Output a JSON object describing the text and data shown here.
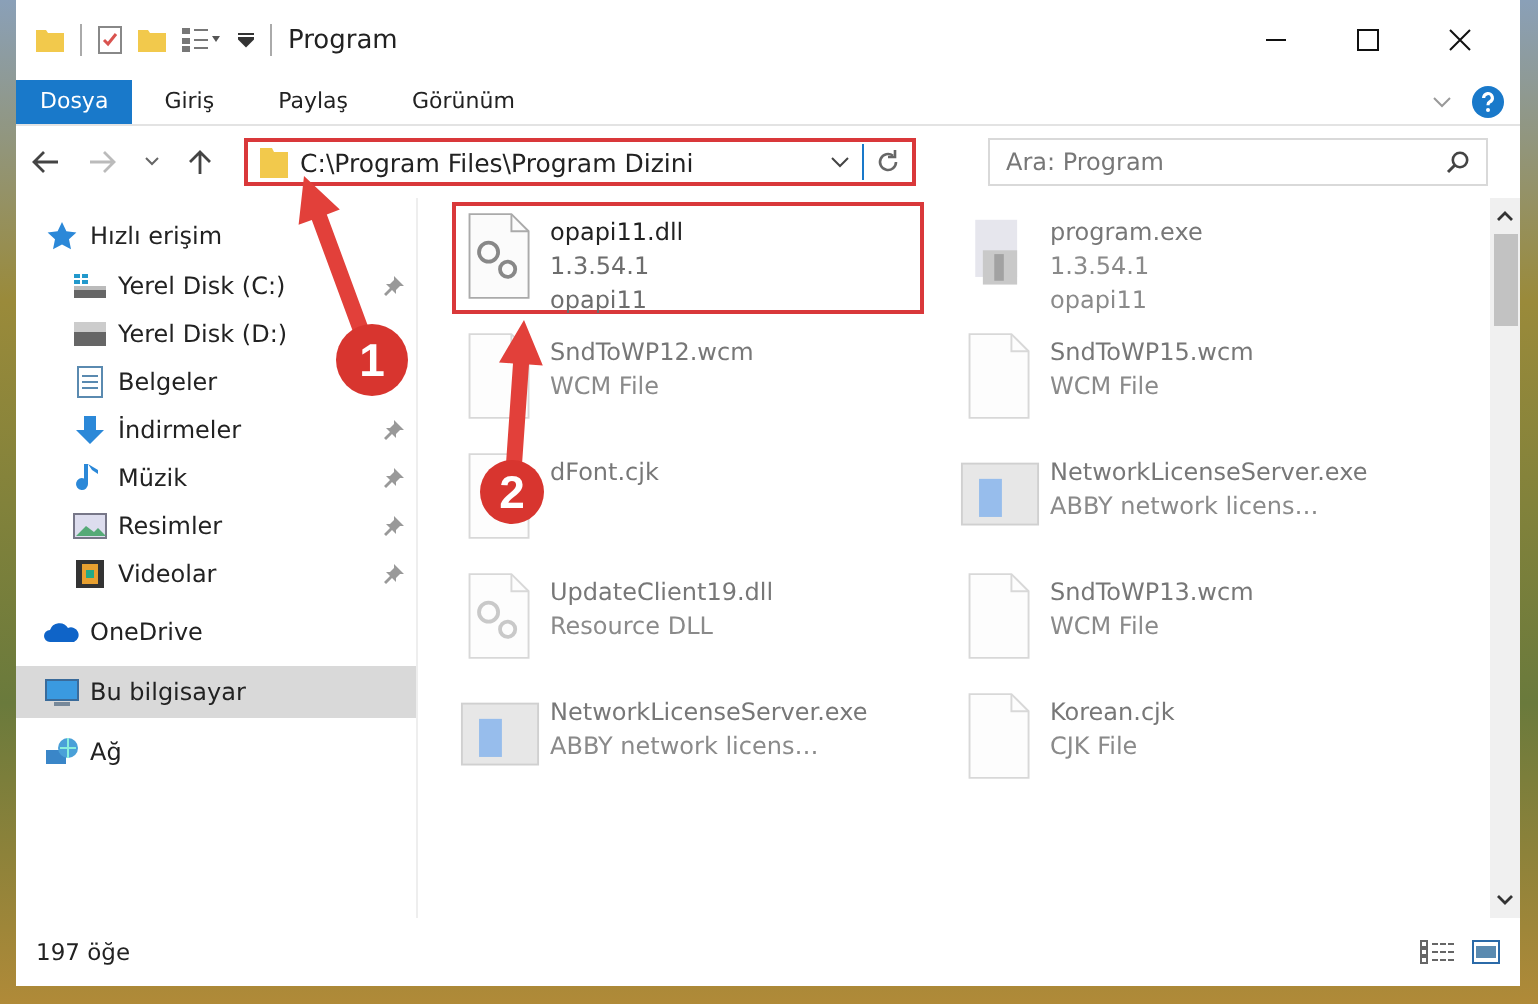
{
  "window": {
    "title": "Program"
  },
  "ribbon_tabs": [
    {
      "label": "Dosya",
      "kind": "file"
    },
    {
      "label": "Giriş",
      "kind": "tab"
    },
    {
      "label": "Paylaş",
      "kind": "tab"
    },
    {
      "label": "Görünüm",
      "kind": "tab"
    }
  ],
  "address_bar": {
    "path": "C:\\Program Files\\Program Dizini",
    "highlighted": true
  },
  "search": {
    "placeholder": "Ara: Program"
  },
  "sidebar": {
    "items": [
      {
        "label": "Hızlı erişim",
        "kind": "star",
        "selected": false,
        "children": [
          {
            "label": "Yerel Disk (C:)",
            "kind": "drive-win",
            "pinned": true
          },
          {
            "label": "Yerel Disk (D:)",
            "kind": "drive",
            "pinned": false
          },
          {
            "label": "Belgeler",
            "kind": "document",
            "pinned": false
          },
          {
            "label": "İndirmeler",
            "kind": "download",
            "pinned": true
          },
          {
            "label": "Müzik",
            "kind": "music",
            "pinned": true
          },
          {
            "label": "Resimler",
            "kind": "image",
            "pinned": true
          },
          {
            "label": "Videolar",
            "kind": "film",
            "pinned": true
          }
        ]
      },
      {
        "label": "OneDrive",
        "kind": "cloud",
        "selected": false
      },
      {
        "label": "Bu bilgisayar",
        "kind": "monitor",
        "selected": true
      },
      {
        "label": "Ağ",
        "kind": "network",
        "selected": false
      }
    ]
  },
  "files": [
    {
      "name": "opapi11.dll",
      "details": [
        "1.3.54.1",
        "opapi11"
      ],
      "kind": "gear-file",
      "highlighted": true,
      "blurred": false
    },
    {
      "name": "program.exe",
      "details": [
        "1.3.54.1",
        "opapi11"
      ],
      "kind": "installer",
      "highlighted": false,
      "blurred": true
    },
    {
      "name": "SndToWP12.wcm",
      "details": [
        "WCM File"
      ],
      "kind": "blank-file",
      "highlighted": false,
      "blurred": true
    },
    {
      "name": "SndToWP15.wcm",
      "details": [
        "WCM File"
      ],
      "kind": "blank-file",
      "highlighted": false,
      "blurred": true
    },
    {
      "name": "dFont.cjk",
      "kind": "blank-file",
      "highlighted": false,
      "blurred": true
    },
    {
      "name": "NetworkLicenseServer.exe",
      "details": [
        "ABBY network licens…"
      ],
      "kind": "app-window",
      "highlighted": false,
      "blurred": true
    },
    {
      "name": "UpdateClient19.dll",
      "details": [
        "Resource DLL"
      ],
      "kind": "gear-file",
      "highlighted": false,
      "blurred": true
    },
    {
      "name": "SndToWP13.wcm",
      "details": [
        "WCM File"
      ],
      "kind": "blank-file",
      "highlighted": false,
      "blurred": true
    },
    {
      "name": "NetworkLicenseServer.exe",
      "details": [
        "ABBY network licens…"
      ],
      "kind": "app-window",
      "highlighted": false,
      "blurred": true
    },
    {
      "name": "Korean.cjk",
      "details": [
        "CJK File"
      ],
      "kind": "blank-file",
      "highlighted": false,
      "blurred": true
    }
  ],
  "status_bar": {
    "item_count": "197 öğe"
  },
  "annotations": [
    {
      "label": "1"
    },
    {
      "label": "2"
    }
  ]
}
